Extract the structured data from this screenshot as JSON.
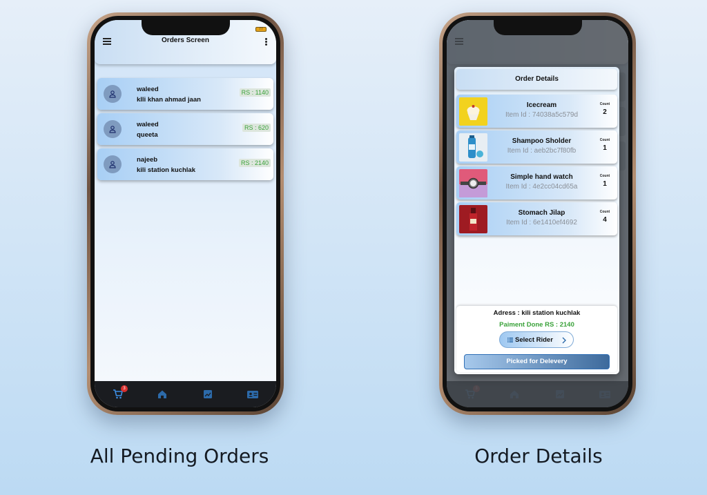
{
  "left_screen": {
    "battery": "77",
    "title": "Orders Screen",
    "orders": [
      {
        "name": "waleed",
        "address": "klli khan ahmad jaan",
        "price": "RS : 1140"
      },
      {
        "name": "waleed",
        "address": "queeta",
        "price": "RS : 620"
      },
      {
        "name": "najeeb",
        "address": "kili station kuchlak",
        "price": "RS : 2140"
      }
    ],
    "nav": {
      "cart_badge": "3"
    }
  },
  "right_screen": {
    "dialog_title": "Order Details",
    "items": [
      {
        "name": "Icecream",
        "item_id": "Item Id : 74038a5c579d",
        "count_label": "Count",
        "count": "2"
      },
      {
        "name": "Shampoo Sholder",
        "item_id": "Item Id : aeb2bc7f80fb",
        "count_label": "Count",
        "count": "1"
      },
      {
        "name": "Simple hand watch",
        "item_id": "Item Id : 4e2cc04cd65a",
        "count_label": "Count",
        "count": "1"
      },
      {
        "name": "Stomach Jilap",
        "item_id": "Item Id : 6e1410ef4692",
        "count_label": "Count",
        "count": "4"
      }
    ],
    "address": "Adress : kili station kuchlak",
    "payment": "Paiment Done RS : 2140",
    "select_rider": "Select Rider",
    "picked_button": "Picked for Delevery",
    "nav": {
      "cart_badge": "3"
    }
  },
  "captions": {
    "left": "All Pending Orders",
    "right": "Order Details"
  },
  "colors": {
    "accent": "#2f6fb6",
    "price_green": "#3aa23a",
    "badge_red": "#d8302f"
  }
}
